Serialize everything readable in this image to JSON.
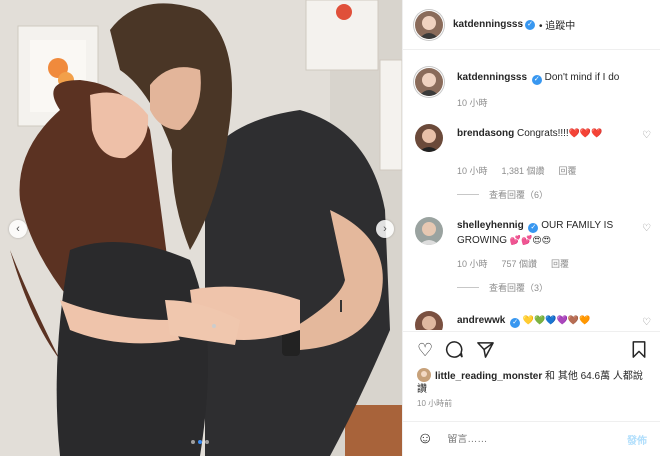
{
  "post": {
    "author": "katdenningsss",
    "following_label": "• 追蹤中",
    "caption": "Don't mind if I do",
    "caption_time": "10 小時",
    "photo_alt": "photo",
    "carousel_count": 3,
    "carousel_active": 1
  },
  "comments": [
    {
      "user": "brendasong",
      "text": "Congrats!!!!",
      "emoji": "❤️❤️❤️",
      "time": "10 小時",
      "likes": "1,381 個讚",
      "reply": "回覆",
      "view_replies": "查看回覆（6）"
    },
    {
      "user": "shelleyhennig",
      "text": "OUR FAMILY IS GROWING",
      "emoji": "💕💕😍😍",
      "time": "10 小時",
      "likes": "757 個讚",
      "reply": "回覆",
      "view_replies": "查看回覆（3）"
    },
    {
      "user": "andrewwk",
      "text": "",
      "emoji": "💛💚💙💜🤎🧡",
      "time": "",
      "likes": "",
      "reply": "",
      "view_replies": ""
    }
  ],
  "likes": {
    "user": "little_reading_monster",
    "text": "和 其他 64.6萬 人都說讚"
  },
  "time_posted": "10 小時前",
  "comment_box": {
    "placeholder": "留言……",
    "post_label": "發佈"
  },
  "icons": {
    "heart": "heart-icon",
    "comment": "comment-icon",
    "share": "share-icon",
    "bookmark": "bookmark-icon",
    "emoji": "smile-icon"
  },
  "colors": {
    "verified": "#3897f0",
    "post_button": "#b2dffc",
    "muted": "#8e8e8e"
  }
}
